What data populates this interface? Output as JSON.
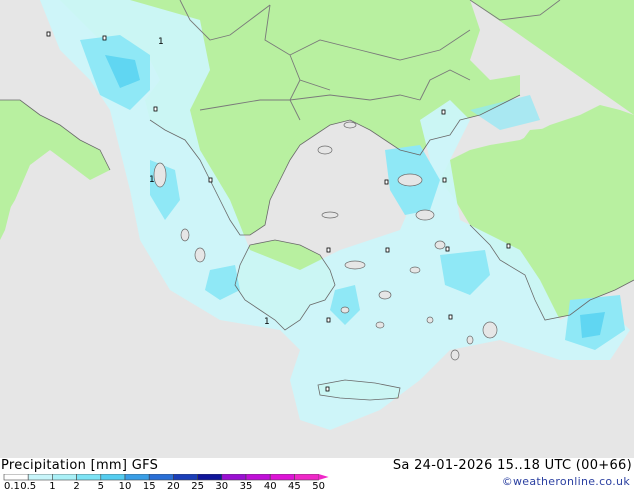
{
  "footer": {
    "title": "Precipitation [mm] GFS",
    "datetime": "Sa 24-01-2026 15..18 UTC (00+66)",
    "credit": "©weatheronline.co.uk"
  },
  "legend": {
    "labels": [
      "0.1",
      "0.5",
      "1",
      "2",
      "5",
      "10",
      "15",
      "20",
      "25",
      "30",
      "35",
      "40",
      "45",
      "50"
    ],
    "colors": [
      "#ffffff",
      "#c8f5fa",
      "#aaf0f7",
      "#7de3f5",
      "#55cdf0",
      "#3a9ee6",
      "#2a6fd6",
      "#1b3fb8",
      "#10169a",
      "#9a10d2",
      "#c010d8",
      "#dd14d6",
      "#ef28c8"
    ]
  },
  "map_labels": [
    "1",
    "1",
    "1"
  ],
  "map": {
    "colors": {
      "sea": "#e6e6e6",
      "land": "#b8f0a0",
      "precip_light": "#ccf6fb",
      "precip_mid": "#8fe8f6",
      "precip_high": "#60d6f2",
      "border": "#888888"
    }
  }
}
